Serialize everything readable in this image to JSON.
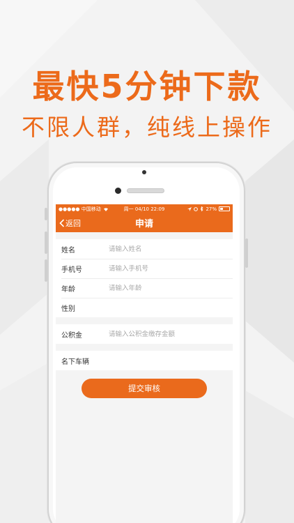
{
  "promo": {
    "headline": "最快5分钟下款",
    "subline": "不限人群，纯线上操作"
  },
  "status_bar": {
    "carrier": "●●●●● 中国移动",
    "time": "周一 04/10 22:09",
    "battery": "27%"
  },
  "nav": {
    "back_label": "返回",
    "title": "申请"
  },
  "form": {
    "group1": [
      {
        "label": "姓名",
        "placeholder": "请输入姓名"
      },
      {
        "label": "手机号",
        "placeholder": "请输入手机号"
      },
      {
        "label": "年龄",
        "placeholder": "请输入年龄"
      },
      {
        "label": "性别",
        "placeholder": ""
      }
    ],
    "group2": [
      {
        "label": "公积金",
        "placeholder": "请输入公积金缴存金额"
      }
    ],
    "group3": [
      {
        "label": "名下车辆",
        "placeholder": ""
      }
    ],
    "submit_label": "提交审核"
  },
  "colors": {
    "accent": "#ea6a1c",
    "headline": "#ec6a1a",
    "background": "#f3f3f3"
  }
}
